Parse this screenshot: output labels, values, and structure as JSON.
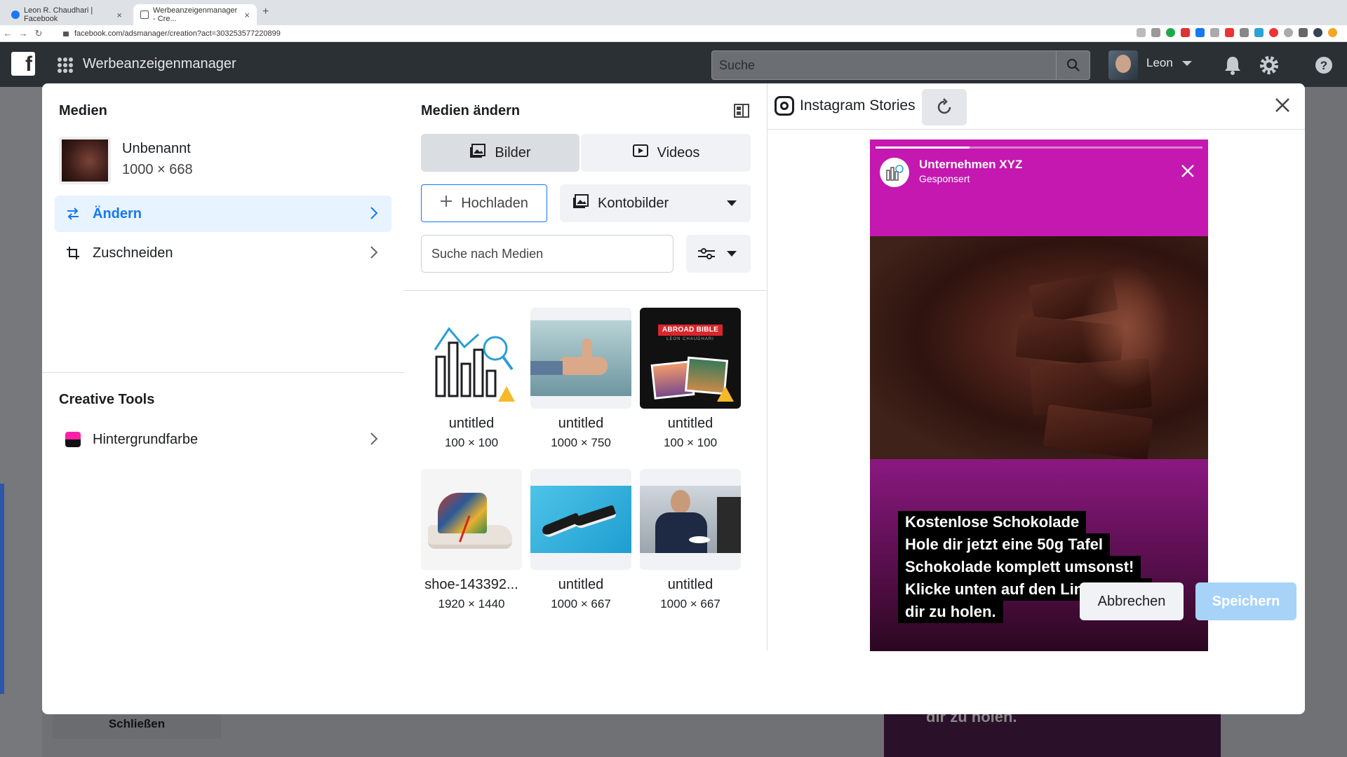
{
  "browser": {
    "tabs": [
      {
        "title": "Leon R. Chaudhari | Facebook"
      },
      {
        "title": "Werbeanzeigenmanager - Cre..."
      }
    ],
    "url": "facebook.com/adsmanager/creation?act=303253577220899"
  },
  "fb_header": {
    "app_title": "Werbeanzeigenmanager",
    "search_placeholder": "Suche",
    "user_name": "Leon"
  },
  "background": {
    "close_label": "Schließen",
    "behind_caption": "dir zu holen."
  },
  "left_panel": {
    "media_heading": "Medien",
    "media_item": {
      "name": "Unbenannt",
      "dimensions": "1000 × 668"
    },
    "menu": [
      {
        "label": "Ändern",
        "active": true
      },
      {
        "label": "Zuschneiden",
        "active": false
      }
    ],
    "creative_tools_heading": "Creative Tools",
    "creative_tools": [
      {
        "label": "Hintergrundfarbe"
      }
    ]
  },
  "middle_panel": {
    "heading": "Medien ändern",
    "tabs": [
      {
        "label": "Bilder",
        "selected": true
      },
      {
        "label": "Videos",
        "selected": false
      }
    ],
    "upload_label": "Hochladen",
    "library_dropdown": "Kontobilder",
    "search_placeholder": "Suche nach Medien",
    "tiles": [
      {
        "name": "untitled",
        "dim": "100 × 100",
        "icon": "chart-magnifier-icon",
        "warning": true
      },
      {
        "name": "untitled",
        "dim": "1000 × 750",
        "icon": "thumbs-up-photo",
        "warning": false
      },
      {
        "name": "untitled",
        "dim": "100 × 100",
        "icon": "abroad-bible-photo",
        "warning": true,
        "badge_text": "ABROAD BIBLE",
        "badge_sub": "LEON CHAUDHARI"
      },
      {
        "name": "shoe-143392...",
        "dim": "1920 × 1440",
        "icon": "sneaker-photo",
        "warning": false
      },
      {
        "name": "untitled",
        "dim": "1000 × 667",
        "icon": "shoes-blue-photo",
        "warning": false
      },
      {
        "name": "untitled",
        "dim": "1000 × 667",
        "icon": "businessman-photo",
        "warning": false
      }
    ]
  },
  "right_panel": {
    "placement_title": "Instagram Stories",
    "story": {
      "account_name": "Unternehmen XYZ",
      "sponsored_label": "Gesponsert",
      "caption_lines": [
        "Kostenlose Schokolade",
        "Hole dir jetzt eine 50g Tafel",
        "Schokolade komplett umsonst!",
        "Klicke unten auf den Link um sie",
        "dir zu holen."
      ],
      "background_color": "#c418b0"
    }
  },
  "footer": {
    "cancel_label": "Abbrechen",
    "save_label": "Speichern"
  },
  "colors": {
    "accent": "#1877f2",
    "save_disabled": "#a7d3f8",
    "warning": "#f7b928"
  }
}
